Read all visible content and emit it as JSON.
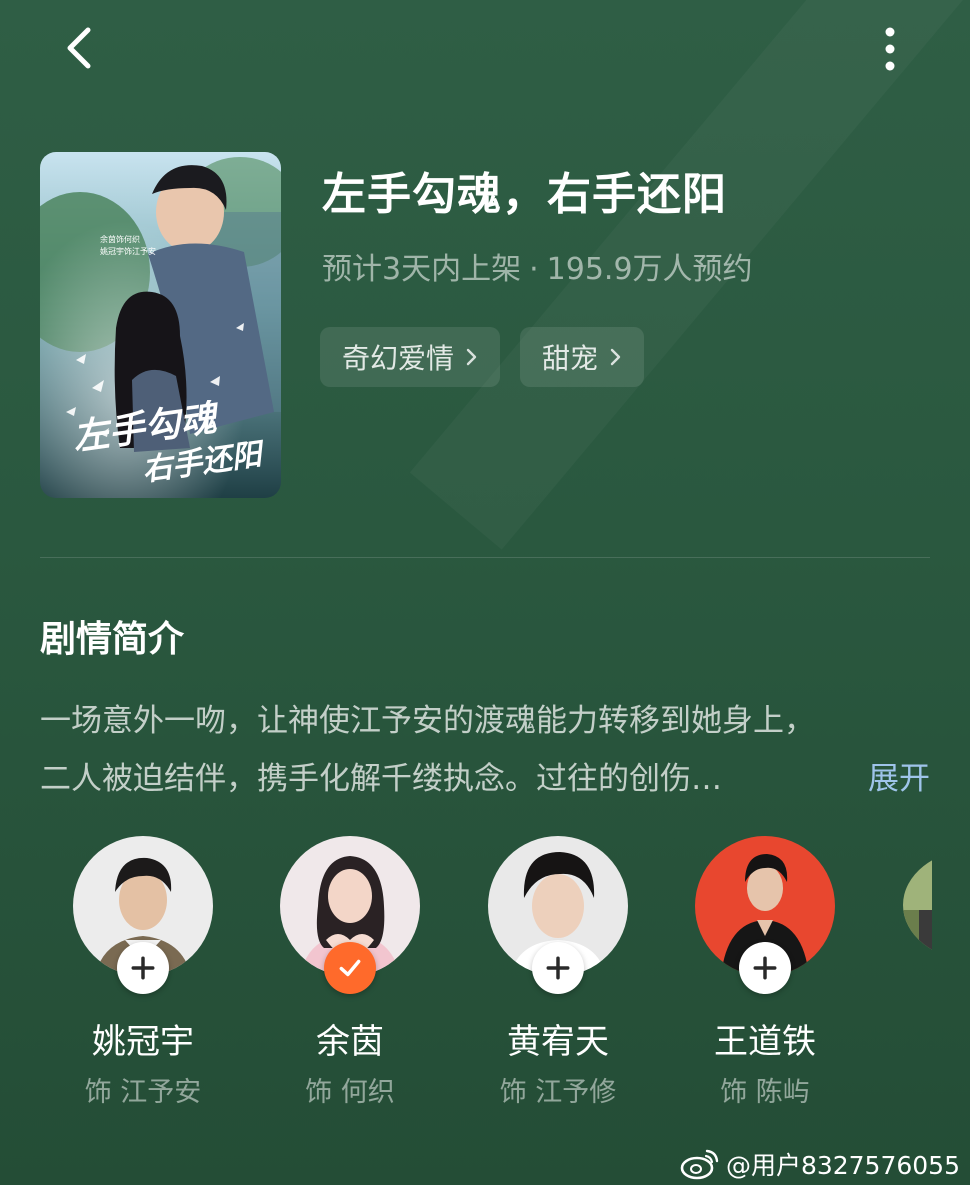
{
  "nav": {
    "back_icon": "chevron-left-icon",
    "more_icon": "more-vertical-icon"
  },
  "drama": {
    "title": "左手勾魂，右手还阳",
    "release_note": "预计3天内上架",
    "separator": "·",
    "reservations": "195.9万人预约",
    "tags": [
      {
        "label": "奇幻爱情"
      },
      {
        "label": "甜宠"
      }
    ]
  },
  "poster": {
    "calligraphy_line1": "左手勾魂",
    "calligraphy_line2": "右手还阳",
    "credit_col1": "余茵饰何织",
    "credit_col2": "姚冠宇饰江予安"
  },
  "synopsis": {
    "heading": "剧情简介",
    "line1": "一场意外一吻，让神使江予安的渡魂能力转移到她身上，",
    "line2": "二人被迫结伴，携手化解千缕执念。过往的创伤…",
    "expand_label": "展开"
  },
  "cast": [
    {
      "name": "姚冠宇",
      "role": "饰 江予安",
      "followed": false
    },
    {
      "name": "余茵",
      "role": "饰 何织",
      "followed": true
    },
    {
      "name": "黄宥天",
      "role": "饰 江予修",
      "followed": false
    },
    {
      "name": "王道铁",
      "role": "饰 陈屿",
      "followed": false
    }
  ],
  "watermark": {
    "text": "@用户8327576055",
    "icon": "weibo-icon"
  },
  "colors": {
    "follow_active": "#ff6a2b",
    "expand_link": "#9fc4ea",
    "background": "#2a583f"
  }
}
